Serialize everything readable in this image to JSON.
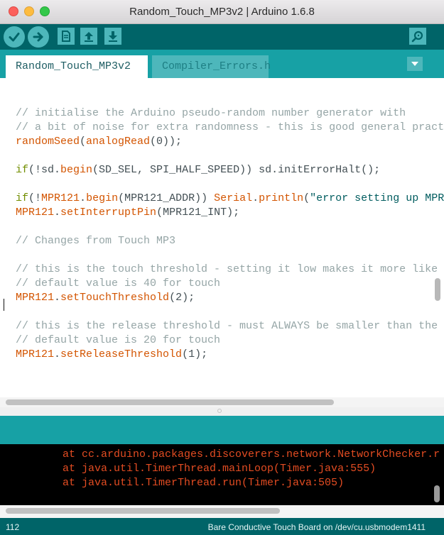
{
  "window": {
    "title": "Random_Touch_MP3v2 | Arduino 1.6.8"
  },
  "toolbar": {
    "verify_icon": "checkmark-icon",
    "upload_icon": "arrow-right-icon",
    "new_icon": "document-icon",
    "open_icon": "arrow-up-icon",
    "save_icon": "arrow-down-icon",
    "monitor_icon": "magnifier-icon"
  },
  "tabs": [
    {
      "label": "Random_Touch_MP3v2",
      "active": true
    },
    {
      "label": "Compiler_Errors.h",
      "active": false
    }
  ],
  "tab_menu_icon": "triangle-down-icon",
  "code": {
    "l1": "// initialise the Arduino pseudo-random number generator with",
    "l2": "// a bit of noise for extra randomness - this is good general pract",
    "l3_fn": "randomSeed",
    "l3_p1": "(",
    "l3_fn2": "analogRead",
    "l3_p2": "(0));",
    "l4_kw": "if",
    "l4_a": "(!sd.",
    "l4_fn": "begin",
    "l4_b": "(SD_SEL, SPI_HALF_SPEED)) sd.initErrorHalt();",
    "l5_kw": "if",
    "l5_a": "(!",
    "l5_fn": "MPR121",
    "l5_b": ".",
    "l5_fn2": "begin",
    "l5_c": "(MPR121_ADDR)) ",
    "l5_kw2": "Serial",
    "l5_d": ".",
    "l5_fn3": "println",
    "l5_e": "(",
    "l5_str": "\"error setting up MPR",
    "l6_fn": "MPR121",
    "l6_a": ".",
    "l6_fn2": "setInterruptPin",
    "l6_b": "(MPR121_INT);",
    "l7": "// Changes from Touch MP3",
    "l8": "// this is the touch threshold - setting it low makes it more like",
    "l9": "// default value is 40 for touch",
    "l10_fn": "MPR121",
    "l10_a": ".",
    "l10_fn2": "setTouchThreshold",
    "l10_b": "(2);",
    "l11": "// this is the release threshold - must ALWAYS be smaller than the",
    "l12": "// default value is 20 for touch",
    "l13_fn": "MPR121",
    "l13_a": ".",
    "l13_fn2": "setReleaseThreshold",
    "l13_b": "(1);"
  },
  "console": [
    "at cc.arduino.packages.discoverers.network.NetworkChecker.r",
    "at java.util.TimerThread.mainLoop(Timer.java:555)",
    "at java.util.TimerThread.run(Timer.java:505)"
  ],
  "status": {
    "line_number": "112",
    "board": "Bare Conductive Touch Board on /dev/cu.usbmodem1411"
  },
  "colors": {
    "toolbar": "#006468",
    "tabbar": "#17a1a5",
    "button": "#4db7bb",
    "comment": "#95a5a6",
    "function": "#d35400",
    "keyword": "#728e00",
    "console_text": "#e34c22"
  }
}
